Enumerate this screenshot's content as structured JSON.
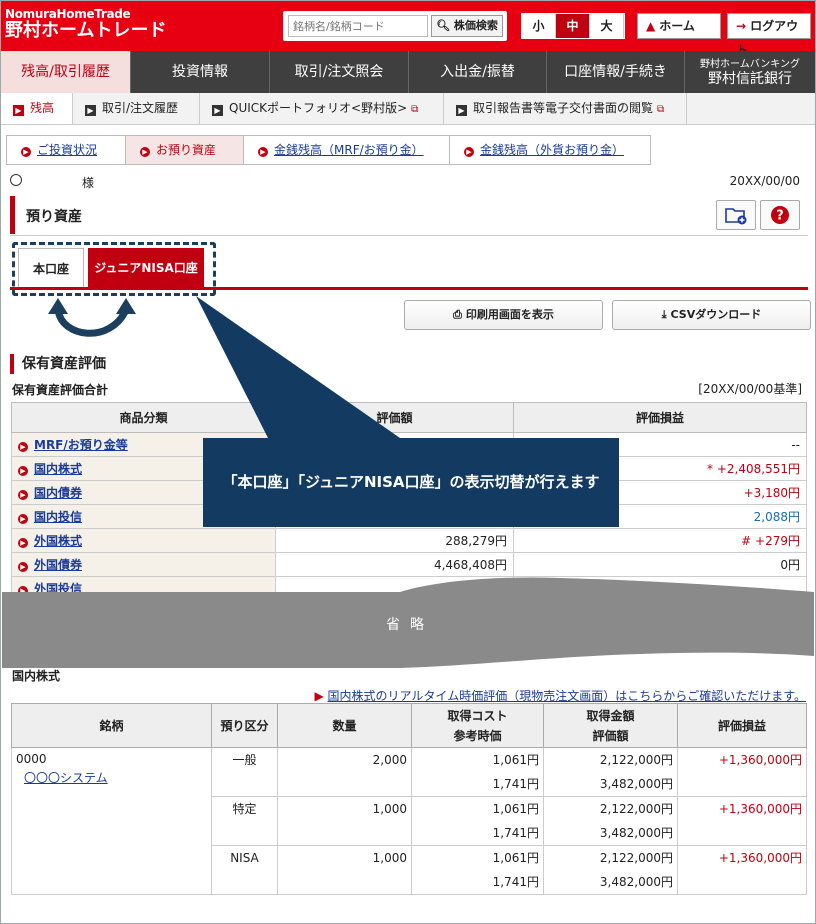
{
  "header": {
    "brand_en": "NomuraHomeTrade",
    "brand_jp": "野村ホームトレード",
    "search_placeholder": "銘柄名/銘柄コード",
    "search_button": "株価検索",
    "font_sizes": [
      "小",
      "中",
      "大"
    ],
    "font_size_active": "中",
    "home_button": "ホーム",
    "logout_button": "ログアウト"
  },
  "gnav": {
    "items": [
      "残高/取引履歴",
      "投資情報",
      "取引/注文照会",
      "入出金/振替",
      "口座情報/手続き"
    ],
    "active": "残高/取引履歴",
    "bank_small": "野村ホームバンキング",
    "bank_label": "野村信託銀行"
  },
  "snav": {
    "items": [
      "残高",
      "取引/注文履歴",
      "QUICKポートフォリオ<野村版>",
      "取引報告書等電子交付書面の閲覧"
    ],
    "active": "残高"
  },
  "tabs": {
    "items": [
      "ご投資状況",
      "お預り資産",
      "金銭残高（MRF/お預り金）",
      "金銭残高（外貨お預り金）"
    ],
    "active": "お預り資産"
  },
  "user": {
    "honorific": "様",
    "date": "20XX/00/00"
  },
  "page_title": "預り資産",
  "account_tabs": {
    "main": "本口座",
    "nisa": "ジュニアNISA口座"
  },
  "actions": {
    "print": "印刷用画面を表示",
    "csv": "CSVダウンロード"
  },
  "summary": {
    "section_title": "保有資産評価",
    "sub_title": "保有資産評価合計",
    "as_of": "[20XX/00/00基準]",
    "headers": [
      "商品分類",
      "評価額",
      "評価損益"
    ],
    "rows": [
      {
        "name": "MRF/お預り金等",
        "value": "",
        "pl": "--"
      },
      {
        "name": "国内株式",
        "value": "",
        "pl": "* +2,408,551円"
      },
      {
        "name": "国内債券",
        "value": "",
        "pl": "+3,180円"
      },
      {
        "name": "国内投信",
        "value": "",
        "pl": "2,088円"
      },
      {
        "name": "外国株式",
        "value": "288,279円",
        "pl": "# +279円"
      },
      {
        "name": "外国債券",
        "value": "4,468,408円",
        "pl": "0円"
      },
      {
        "name": "外国投信",
        "value": "",
        "pl": ""
      }
    ]
  },
  "callout": "「本口座」「ジュニアNISA口座」の表示切替が行えます",
  "omitted": "省略",
  "domestic": {
    "title": "国内株式",
    "link": "国内株式のリアルタイム時価評価（現物売注文画面）はこちらからご確認いただけます。",
    "headers": {
      "stock": "銘柄",
      "kubun": "預り区分",
      "qty": "数量",
      "cost1": "取得コスト",
      "cost2": "参考時価",
      "amt1": "取得金額",
      "amt2": "評価額",
      "pl": "評価損益"
    },
    "stock_code": "0000",
    "stock_name": "〇〇〇システム",
    "rows": [
      {
        "kubun": "一般",
        "qty": "2,000",
        "cost": "1,061円",
        "price": "1,741円",
        "amount": "2,122,000円",
        "value": "3,482,000円",
        "pl": "+1,360,000円"
      },
      {
        "kubun": "特定",
        "qty": "1,000",
        "cost": "1,061円",
        "price": "1,741円",
        "amount": "2,122,000円",
        "value": "3,482,000円",
        "pl": "+1,360,000円"
      },
      {
        "kubun": "NISA",
        "qty": "1,000",
        "cost": "1,061円",
        "price": "1,741円",
        "amount": "2,122,000円",
        "value": "3,482,000円",
        "pl": "+1,360,000円"
      }
    ]
  },
  "colors": {
    "brand_red": "#e60012",
    "nav_dark": "#3f3f3f",
    "callout_navy": "#133b62",
    "omit_gray": "#8a8a8a"
  }
}
